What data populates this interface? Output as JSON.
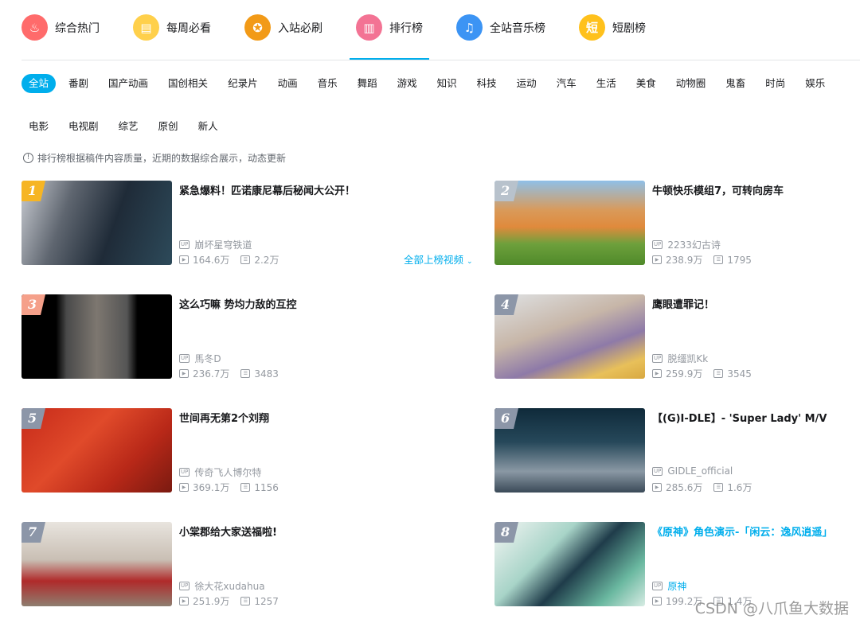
{
  "nav": [
    {
      "label": "综合热门",
      "icon": "fire-icon",
      "color": "#ff6b6b",
      "glyph": "♨"
    },
    {
      "label": "每周必看",
      "icon": "calendar-icon",
      "color": "#ffd04b",
      "glyph": "▤"
    },
    {
      "label": "入站必刷",
      "icon": "medal-icon",
      "color": "#f29a17",
      "glyph": "✪"
    },
    {
      "label": "排行榜",
      "icon": "podium-icon",
      "color": "#f37394",
      "glyph": "▥",
      "active": true
    },
    {
      "label": "全站音乐榜",
      "icon": "headphones-icon",
      "color": "#3c94f4",
      "glyph": "♫"
    },
    {
      "label": "短剧榜",
      "icon": "short-drama-icon",
      "color": "#ffc11c",
      "glyph": "短"
    }
  ],
  "categories": [
    "全站",
    "番剧",
    "国产动画",
    "国创相关",
    "纪录片",
    "动画",
    "音乐",
    "舞蹈",
    "游戏",
    "知识",
    "科技",
    "运动",
    "汽车",
    "生活",
    "美食",
    "动物圈",
    "鬼畜",
    "时尚",
    "娱乐",
    "电影",
    "电视剧",
    "综艺",
    "原创",
    "新人"
  ],
  "tip": "排行榜根据稿件内容质量，近期的数据综合展示，动态更新",
  "more_label": "全部上榜视频",
  "rank_colors": {
    "1": "#f6b524",
    "2": "#b8c2cc",
    "3": "#f5a08a",
    "other": "#8c96a8"
  },
  "videos": [
    {
      "rank": "1",
      "title": "紧急爆料！匹诺康尼幕后秘闻大公开！",
      "up": "崩坏星穹铁道",
      "views": "164.6万",
      "danmaku": "2.2万",
      "thumb": "linear-gradient(110deg,#c9ccd2 0%,#5f6670 30%,#1f2b38 60%,#2d4a5a 100%)"
    },
    {
      "rank": "2",
      "title": "牛顿快乐模组7，可转向房车",
      "up": "2233幻古诗",
      "views": "238.9万",
      "danmaku": "1795",
      "thumb": "linear-gradient(180deg,#8fc0e8 0%,#d99a5a 35%,#e08a3c 55%,#6ea03c 75%,#4f8a2a 100%)"
    },
    {
      "rank": "3",
      "title": "这么巧嘛 势均力敌的互控",
      "up": "馬冬D",
      "views": "236.7万",
      "danmaku": "3483",
      "thumb": "linear-gradient(90deg,#000 0%,#000 23%,#4a4a4a 30%,#7d7770 50%,#555 70%,#000 77%,#000 100%)"
    },
    {
      "rank": "4",
      "title": "鹰眼遭罪记！",
      "up": "脱缰凯Kk",
      "views": "259.9万",
      "danmaku": "3545",
      "thumb": "linear-gradient(160deg,#dfe2e4 0%,#c7b6a8 40%,#8e7aa8 65%,#e8c05a 85%,#d8a840 100%)"
    },
    {
      "rank": "5",
      "title": "世间再无第2个刘翔",
      "up": "传奇飞人博尔特",
      "views": "369.1万",
      "danmaku": "1156",
      "thumb": "linear-gradient(135deg,#c62a1a 0%,#e04a2a 40%,#b82818 70%,#7a1a10 100%)"
    },
    {
      "rank": "6",
      "title": "【(G)I-DLE】- 'Super Lady' M/V",
      "up": "GIDLE_official",
      "views": "285.6万",
      "danmaku": "1.6万",
      "thumb": "linear-gradient(180deg,#0f2a3a 0%,#26485a 40%,#8a98a4 75%,#3a4a58 100%)"
    },
    {
      "rank": "7",
      "title": "小棠郡给大家送福啦!",
      "up": "徐大花xudahua",
      "views": "251.9万",
      "danmaku": "1257",
      "thumb": "linear-gradient(180deg,#e8e4de 0%,#c9bfb4 45%,#b02a2a 70%,#8e7e70 100%)"
    },
    {
      "rank": "8",
      "title": "《原神》角色演示-「闲云：逸风逍遥」",
      "up": "原神",
      "views": "199.2万",
      "danmaku": "1.4万",
      "link": true,
      "thumb": "linear-gradient(135deg,#f4f6f4 0%,#a8d4c8 35%,#1f3c4a 55%,#6ab8a0 80%,#d8ece4 100%)"
    }
  ],
  "watermark": "CSDN @八爪鱼大数据"
}
